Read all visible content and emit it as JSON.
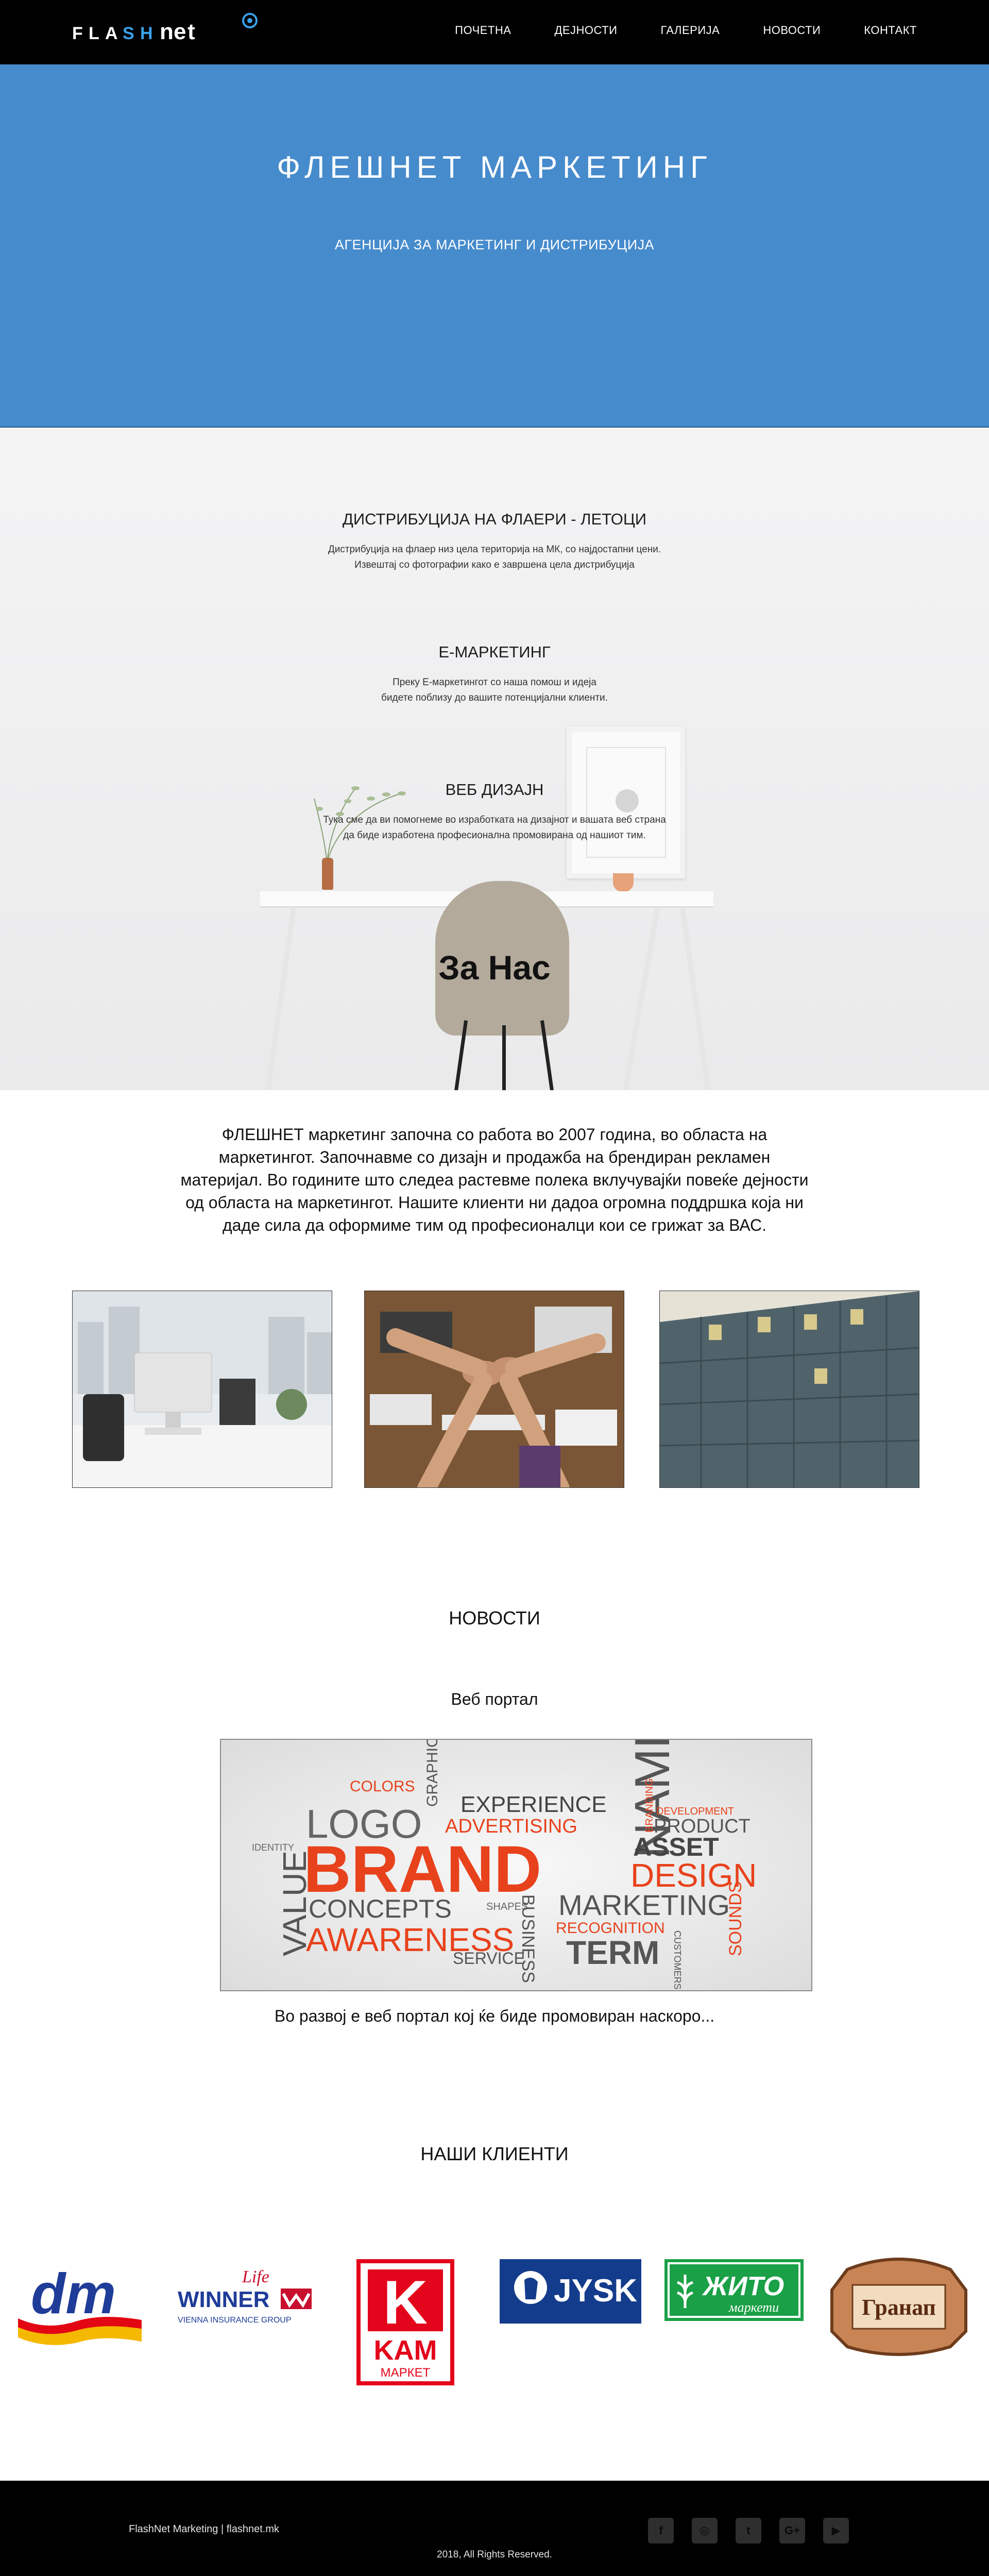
{
  "nav": {
    "logo": {
      "letters": [
        "F",
        "L",
        "A",
        "S",
        "H",
        "n",
        "e",
        "t"
      ]
    },
    "items": [
      "ПОЧЕТНА",
      "ДЕЈНОСТИ",
      "ГАЛЕРИЈА",
      "НОВОСТИ",
      "КОНТАКТ"
    ]
  },
  "hero": {
    "title": "ФЛЕШНЕТ МАРКЕТИНГ",
    "subtitle": "АГЕНЦИЈА ЗА МАРКЕТИНГ И ДИСТРИБУЦИЈА"
  },
  "services": [
    {
      "title": "ДИСТРИБУЦИЈА НА ФЛАЕРИ - ЛЕТОЦИ",
      "lines": [
        "Дистрибуција на флаер низ цела територија на МК, со најдостапни цени.",
        "Извештај со фотографии како е завршена цела дистрибуција"
      ]
    },
    {
      "title": "Е-МАРКЕТИНГ",
      "lines": [
        "Преку Е-маркетингот со наша помош и идеја",
        "бидете поблизу до вашите потенцијални клиенти."
      ]
    },
    {
      "title": "ВЕБ ДИЗАЈН",
      "lines": [
        "Тука сме да ви помогнеме во изработката на дизајнот и вашата веб страна",
        "да биде изработена професионална промовирана од нашиот тим."
      ]
    }
  ],
  "about": {
    "heading": "За Нас",
    "lines": [
      "ФЛЕШНЕТ маркетинг започна со работа во 2007 година, во областа на",
      "маркетингот. Започнавме со дизајн и продажба на брендиран рекламен",
      "материјал. Во годините што следеа растевме полека вклучувајќи повеќе дејности",
      "од областа на маркетингот. Нашите клиенти ни дадоа огромна  поддршка која ни",
      "даде сила да оформиме тим од професионалци кои се грижат за ВАС."
    ]
  },
  "news": {
    "title": "НОВОСТИ",
    "subtitle": "Веб портал",
    "caption": "Во развој е веб портал кој ќе биде промовиран наскоро...",
    "wordcloud": [
      "COLORS",
      "GRAPHICS",
      "EXPERIENCE",
      "NAME",
      "BRANDING",
      "DEVELOPMENT",
      "LOGO",
      "ADVERTISING",
      "PRODUCT",
      "IDENTITY",
      "BRAND",
      "ASSET",
      "VALUE",
      "DESIGN",
      "CONCEPTS",
      "SHAPES",
      "MARKETING",
      "AWARENESS",
      "BUSINESS",
      "RECOGNITION",
      "SOUNDS",
      "SERVICE",
      "TERM",
      "CUSTOMERS"
    ]
  },
  "clients": {
    "title": "НАШИ КЛИЕНТИ",
    "logos": {
      "dm": "dm",
      "winner_life": "Life",
      "winner": "WINNER",
      "winner_sub": "VIENNA INSURANCE GROUP",
      "kam_letter": "K",
      "kam_name": "KAM",
      "kam_sub": "МАРКЕТ",
      "jysk": "JYSK",
      "zhito": "ЖИТО",
      "zhito_sub": "маркети",
      "granap": "Гранап"
    }
  },
  "footer": {
    "left": "FlashNet Marketing | flashnet.mk",
    "copyright": "2018, All Rights Reserved.",
    "social": [
      "f",
      "◎",
      "t",
      "G+",
      "▶"
    ]
  },
  "colors": {
    "hero_blue": "#468bcc",
    "logo_accent": "#3aa0e8",
    "brand_red": "#e8421c"
  }
}
